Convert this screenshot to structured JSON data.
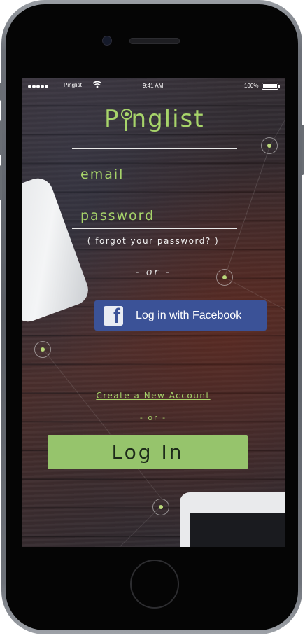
{
  "status_bar": {
    "carrier": "Pinglist",
    "time": "9:41 AM",
    "battery": "100%"
  },
  "app": {
    "logo_prefix": "P",
    "logo_suffix": "nglist",
    "email_placeholder": "email",
    "password_placeholder": "password",
    "forgot_label": "( forgot your password? )",
    "or_label_1": "- or -",
    "facebook_button": "Log in with Facebook",
    "facebook_icon_glyph": "f",
    "create_account_link": "Create a New Account",
    "or_label_2": "- or -",
    "login_button": "Log In"
  },
  "colors": {
    "accent": "#a7d46a",
    "login_button": "#96c46c",
    "facebook": "#3b5297"
  },
  "icons": [
    "wifi-icon",
    "battery-icon",
    "pin-icon",
    "facebook-icon"
  ]
}
